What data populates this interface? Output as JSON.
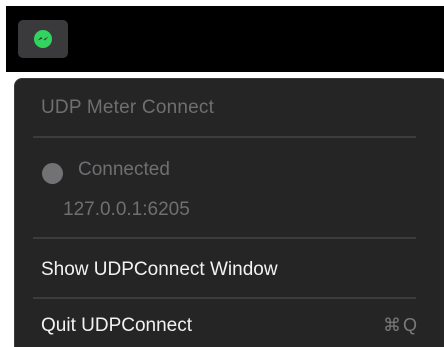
{
  "menubar": {
    "status_item_icon": "messenger-chat-icon",
    "status_item_color": "#33d35f"
  },
  "menu": {
    "header": "UDP Meter Connect",
    "status": {
      "label": "Connected",
      "indicator_color": "#727274"
    },
    "address": "127.0.0.1:6205",
    "items": [
      {
        "label": "Show UDPConnect Window",
        "shortcut": ""
      },
      {
        "label": "Quit UDPConnect",
        "shortcut": "⌘Q"
      }
    ]
  }
}
